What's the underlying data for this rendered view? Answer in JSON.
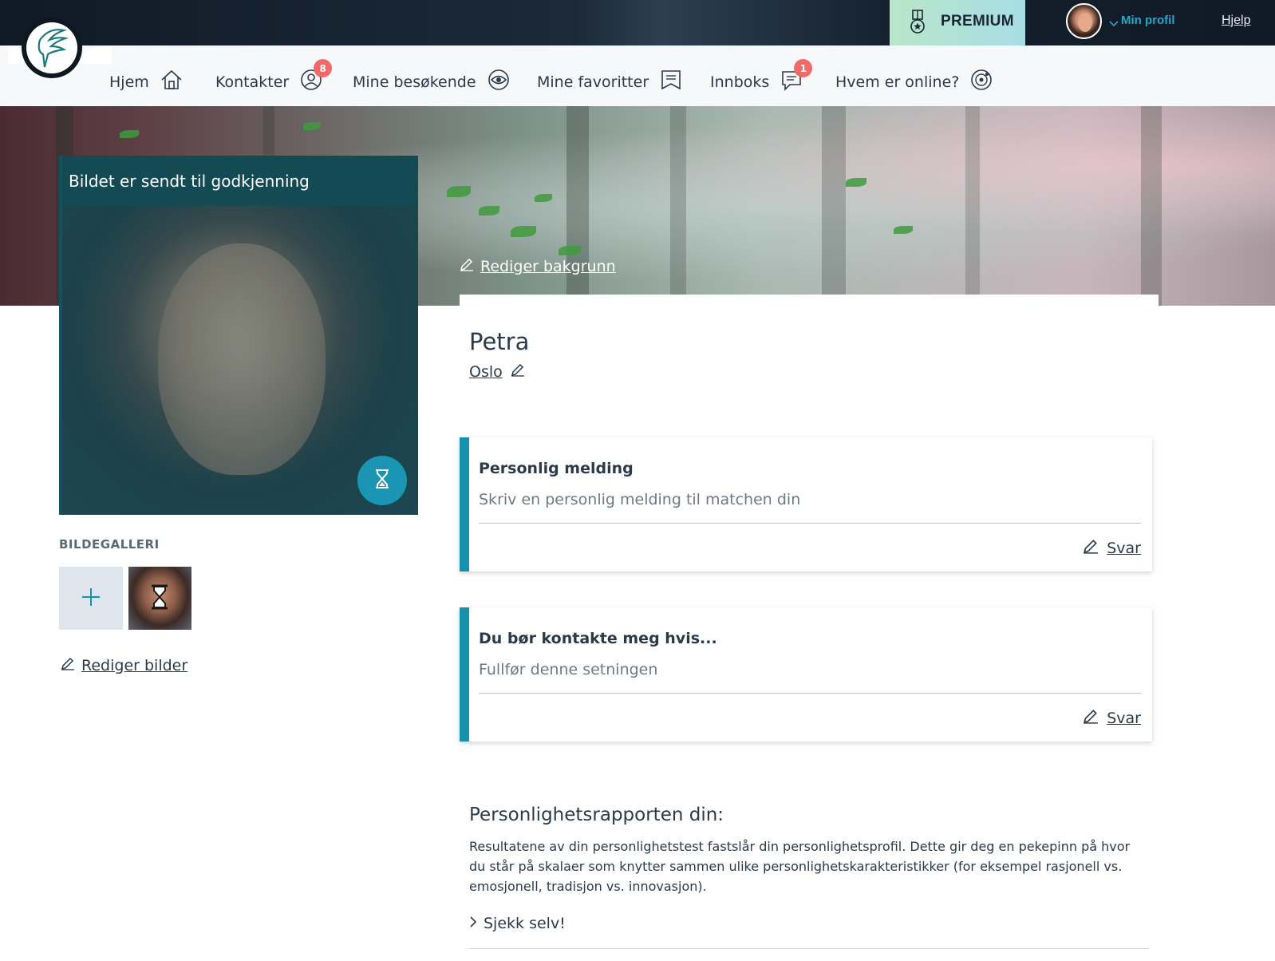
{
  "topbar": {
    "premium_label": "PREMIUM",
    "profile_label": "Min profil",
    "help_label": "Hjelp"
  },
  "nav": {
    "items": [
      {
        "label": "Hjem",
        "icon": "home-icon"
      },
      {
        "label": "Kontakter",
        "icon": "user-icon",
        "badge": "8"
      },
      {
        "label": "Mine besøkende",
        "icon": "eye-icon"
      },
      {
        "label": "Mine favoritter",
        "icon": "bookmark-icon"
      },
      {
        "label": "Innboks",
        "icon": "chat-icon",
        "badge": "1"
      },
      {
        "label": "Hvem er online?",
        "icon": "online-icon"
      }
    ]
  },
  "hero": {
    "edit_background_label": "Rediger bakgrunn"
  },
  "photo": {
    "status_banner": "Bildet er sendt til godkjenning"
  },
  "gallery": {
    "title": "BILDEGALLERI",
    "edit_label": "Rediger bilder"
  },
  "profile": {
    "name": "Petra",
    "city": "Oslo"
  },
  "questions": [
    {
      "title": "Personlig melding",
      "hint": "Skriv en personlig melding til matchen din",
      "reply_label": "Svar"
    },
    {
      "title": "Du bør kontakte meg hvis...",
      "hint": "Fullfør denne setningen",
      "reply_label": "Svar"
    }
  ],
  "report": {
    "title": "Personlighetsrapporten din:",
    "text": "Resultatene av din personlighetstest fastslår din personlighetsprofil. Dette gir deg en pekepinn på hvor du står på skalaer som knytter sammen ulike personlighetskarakteristikker (for eksempel rasjonell vs. emosjonell, tradisjon vs. innovasjon).",
    "check_label": "Sjekk selv!"
  },
  "colors": {
    "accent": "#1590ad",
    "badge": "#f06a6a",
    "topbar": "#0f1a26",
    "premium_start": "#b9e6c9",
    "premium_end": "#a7dde6",
    "profile_link": "#2aa5c7"
  }
}
